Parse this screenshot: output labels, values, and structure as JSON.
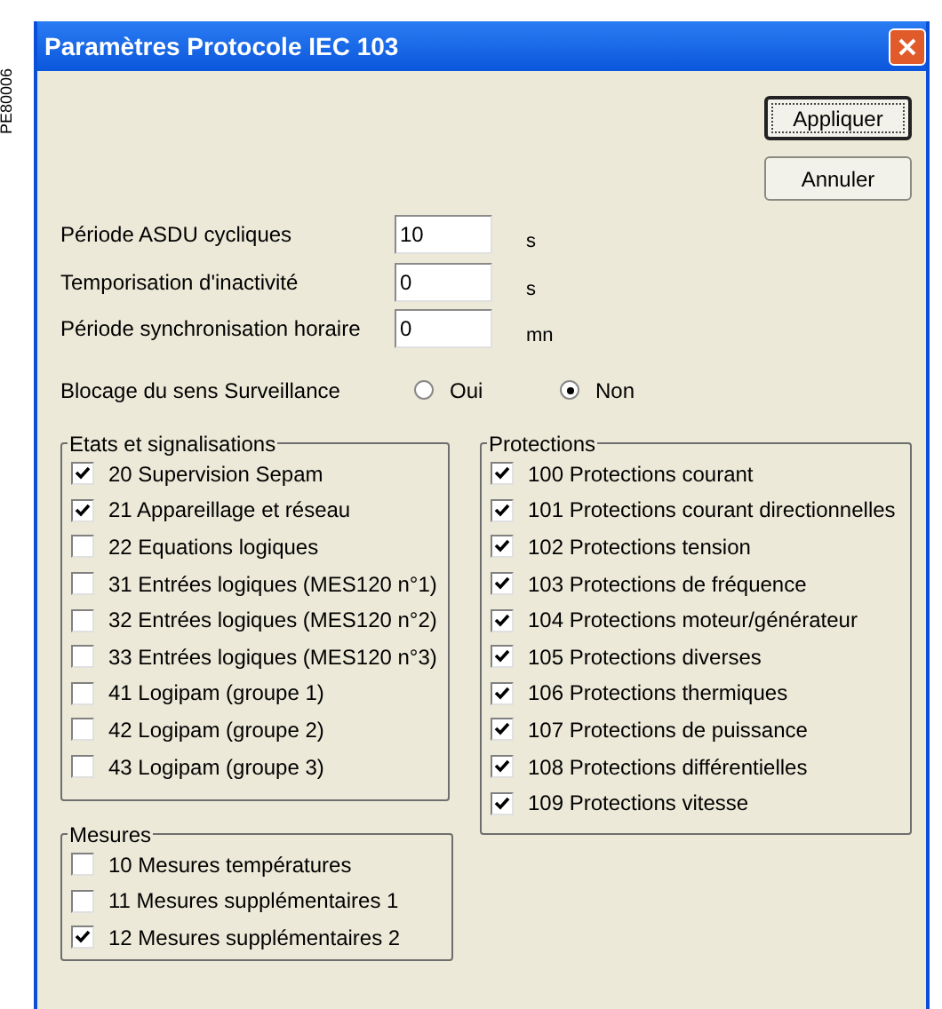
{
  "side_label": "PE80006",
  "window": {
    "title": "Paramètres Protocole IEC 103"
  },
  "buttons": [
    {
      "label": "Appliquer",
      "default": true
    },
    {
      "label": "Annuler",
      "default": false
    }
  ],
  "fields": [
    {
      "label": "Période ASDU cycliques",
      "value": "10",
      "unit": "s"
    },
    {
      "label": "Temporisation d'inactivité",
      "value": "0",
      "unit": "s"
    },
    {
      "label": "Période synchronisation horaire",
      "value": "0",
      "unit": "mn"
    }
  ],
  "radio_group": {
    "label": "Blocage du sens Surveillance",
    "options": [
      {
        "label": "Oui",
        "selected": false
      },
      {
        "label": "Non",
        "selected": true
      }
    ]
  },
  "etats": {
    "title": "Etats et signalisations",
    "items": [
      {
        "label": "20 Supervision Sepam",
        "checked": true
      },
      {
        "label": "21 Appareillage et réseau",
        "checked": true
      },
      {
        "label": "22 Equations logiques",
        "checked": false
      },
      {
        "label": "31 Entrées logiques (MES120 n°1)",
        "checked": false
      },
      {
        "label": "32 Entrées logiques (MES120 n°2)",
        "checked": false
      },
      {
        "label": "33 Entrées logiques (MES120 n°3)",
        "checked": false
      },
      {
        "label": "41 Logipam (groupe 1)",
        "checked": false
      },
      {
        "label": "42 Logipam (groupe 2)",
        "checked": false
      },
      {
        "label": "43 Logipam (groupe 3)",
        "checked": false
      }
    ]
  },
  "mesures": {
    "title": "Mesures",
    "items": [
      {
        "label": "10 Mesures températures",
        "checked": false
      },
      {
        "label": "11 Mesures supplémentaires 1",
        "checked": false
      },
      {
        "label": "12 Mesures supplémentaires 2",
        "checked": true
      }
    ]
  },
  "protections": {
    "title": "Protections",
    "items": [
      {
        "label": "100 Protections courant",
        "checked": true
      },
      {
        "label": "101 Protections courant directionnelles",
        "checked": true
      },
      {
        "label": "102 Protections tension",
        "checked": true
      },
      {
        "label": "103 Protections de fréquence",
        "checked": true
      },
      {
        "label": "104 Protections moteur/générateur",
        "checked": true
      },
      {
        "label": "105 Protections diverses",
        "checked": true
      },
      {
        "label": "106 Protections thermiques",
        "checked": true
      },
      {
        "label": "107 Protections de puissance",
        "checked": true
      },
      {
        "label": "108 Protections différentielles",
        "checked": true
      },
      {
        "label": "109 Protections vitesse",
        "checked": true
      }
    ]
  }
}
